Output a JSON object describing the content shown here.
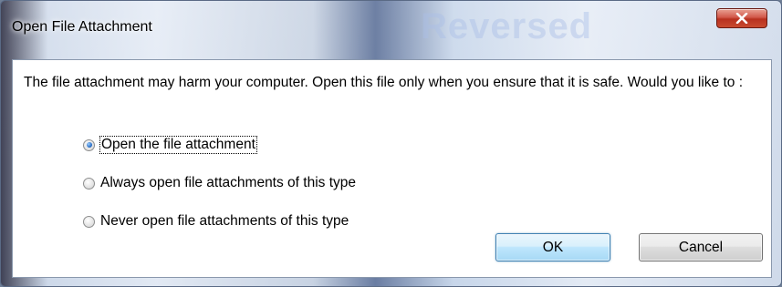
{
  "window": {
    "title": "Open File Attachment",
    "background_watermark": "Reversed",
    "close_icon": "close-icon"
  },
  "dialog": {
    "message": "The file attachment may harm your computer. Open this file only when you ensure that it is safe. Would you like to :",
    "options": [
      {
        "label": "Open the file attachment",
        "checked": true
      },
      {
        "label": "Always open file attachments of this type",
        "checked": false
      },
      {
        "label": "Never open file attachments of this type",
        "checked": false
      }
    ],
    "ok_label": "OK",
    "cancel_label": "Cancel"
  },
  "colors": {
    "close_button": "#c94a2f",
    "ok_border": "#3c7fb1",
    "radio_selected": "#2e72c8"
  }
}
